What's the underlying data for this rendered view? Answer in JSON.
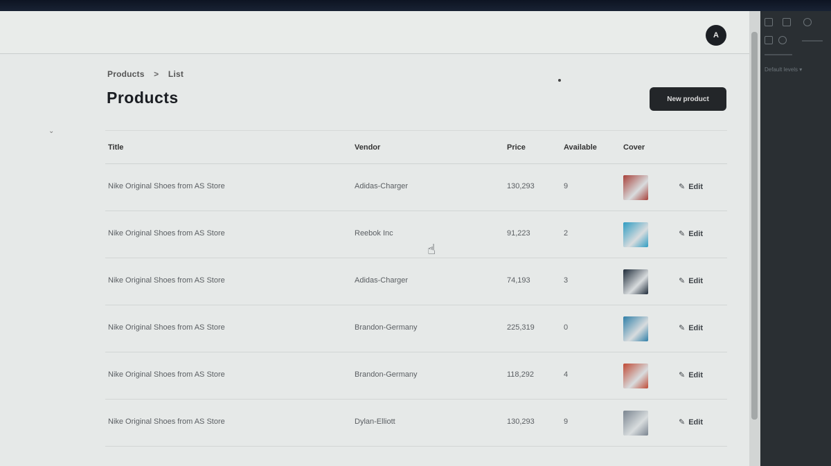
{
  "header": {
    "avatar_initial": "A"
  },
  "breadcrumb": {
    "parent": "Products",
    "separator": ">",
    "current": "List"
  },
  "page": {
    "title": "Products",
    "new_button_label": "New product"
  },
  "table": {
    "columns": [
      "Title",
      "Vendor",
      "Price",
      "Available",
      "Cover",
      ""
    ],
    "edit_label": "Edit",
    "rows": [
      {
        "title": "Nike Original Shoes from AS Store",
        "vendor": "Adidas-Charger",
        "price": "130,293",
        "available": "9",
        "cover_color": "#a8413a"
      },
      {
        "title": "Nike Original Shoes from AS Store",
        "vendor": "Reebok Inc",
        "price": "91,223",
        "available": "2",
        "cover_color": "#2e9cc2"
      },
      {
        "title": "Nike Original Shoes from AS Store",
        "vendor": "Adidas-Charger",
        "price": "74,193",
        "available": "3",
        "cover_color": "#1f2c3a"
      },
      {
        "title": "Nike Original Shoes from AS Store",
        "vendor": "Brandon-Germany",
        "price": "225,319",
        "available": "0",
        "cover_color": "#2f7fa8"
      },
      {
        "title": "Nike Original Shoes from AS Store",
        "vendor": "Brandon-Germany",
        "price": "118,292",
        "available": "4",
        "cover_color": "#c04a35"
      },
      {
        "title": "Nike Original Shoes from AS Store",
        "vendor": "Dylan-Elliott",
        "price": "130,293",
        "available": "9",
        "cover_color": "#7a8590"
      }
    ]
  },
  "devtools": {
    "dropdown_label": "Default levels ▾"
  },
  "colors": {
    "primary_button": "#232629",
    "background": "#e6e9e8"
  }
}
